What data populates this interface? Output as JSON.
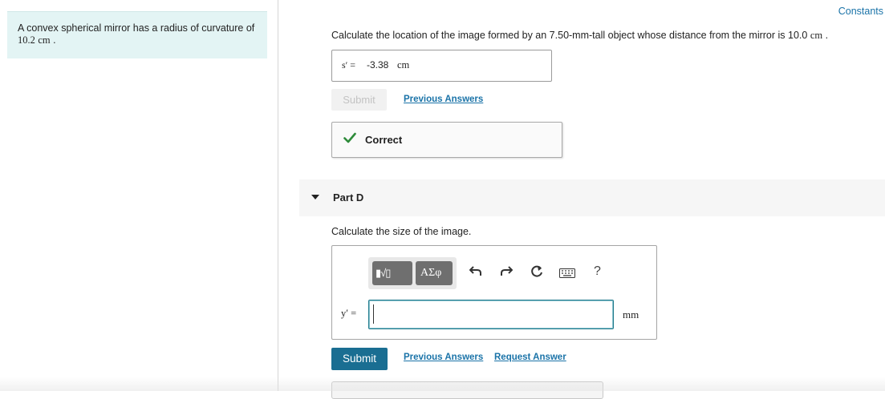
{
  "problem": {
    "text_prefix": "A convex spherical mirror has a radius of curvature of ",
    "value": "10.2",
    "unit": "cm",
    "text_suffix": " ."
  },
  "header": {
    "constants_link": "Constants"
  },
  "part_c": {
    "prompt": "Calculate the location of the image formed by an 7.50-mm-tall object whose distance from the mirror is 10.0",
    "prompt_unit": "cm",
    "prompt_end": " .",
    "answer_label": "s′ =",
    "answer_value": "-3.38",
    "answer_unit": "cm",
    "submit_label": "Submit",
    "previous_answers_label": "Previous Answers",
    "feedback_label": "Correct"
  },
  "part_d": {
    "title": "Part D",
    "prompt": "Calculate the size of the image.",
    "toolbar": {
      "templates_label": "▮√▯",
      "symbols_label": "ΑΣφ",
      "help_label": "?"
    },
    "input_label": "y′ =",
    "input_value": "",
    "unit": "mm",
    "submit_label": "Submit",
    "previous_answers_label": "Previous Answers",
    "request_answer_label": "Request Answer"
  },
  "colors": {
    "accent": "#1a73a8",
    "submit_bg": "#1a6e92",
    "correct_check": "#2e8b3a",
    "problem_bg": "#e3f4f4"
  }
}
